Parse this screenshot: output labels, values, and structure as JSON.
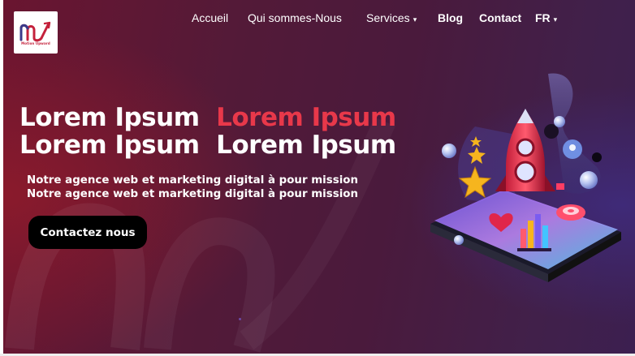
{
  "brand": {
    "name": "Motion Upward",
    "colors": {
      "accent": "#e8384a",
      "cta": "#000000",
      "text": "#ffffff"
    }
  },
  "nav": {
    "items": [
      {
        "label": "Accueil",
        "dropdown": false
      },
      {
        "label": "Qui sommes-Nous",
        "dropdown": false
      },
      {
        "label": "Services",
        "dropdown": true
      },
      {
        "label": "Blog",
        "dropdown": false
      },
      {
        "label": "Contact",
        "dropdown": false
      },
      {
        "label": "FR",
        "dropdown": true
      }
    ],
    "caret_glyph": "▾"
  },
  "hero": {
    "headline": {
      "line1_white": "Lorem Ipsum",
      "line1_accent": "Lorem Ipsum",
      "line2_a": "Lorem Ipsum",
      "line2_b": "Lorem Ipsum"
    },
    "subtitle": {
      "line1": "Notre agence web et marketing digital à pour mission",
      "line2": "Notre agence web et marketing digital à pour mission"
    },
    "cta_label": "Contactez nous"
  },
  "icons": {
    "logo": "motion-upward-logo",
    "illustration": "rocket-analytics-illustration",
    "caret": "chevron-down-icon"
  }
}
